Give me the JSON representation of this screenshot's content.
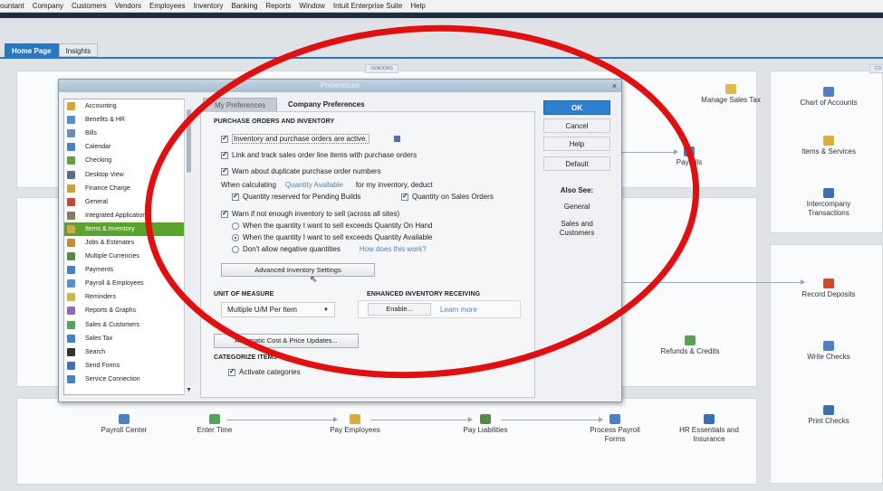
{
  "menu": [
    "ountant",
    "Company",
    "Customers",
    "Vendors",
    "Employees",
    "Inventory",
    "Banking",
    "Reports",
    "Window",
    "Intuit Enterprise Suite",
    "Help"
  ],
  "home": {
    "tabs": [
      "Home Page",
      "Insights"
    ],
    "section_vendors": "VENDORS",
    "right_top": [
      {
        "label": "Manage Sales Tax",
        "icon": "sales-tax-icon"
      },
      {
        "label": "Chart of Accounts",
        "icon": "chart-of-accounts-icon"
      },
      {
        "label": "Items & Services",
        "icon": "items-services-icon"
      },
      {
        "label": "Intercompany Transactions",
        "icon": "intercompany-icon"
      }
    ],
    "payrolls": "Payrolls",
    "record_deposits": "Record Deposits",
    "refunds_credits": "Refunds & Credits",
    "write_checks": "Write Checks",
    "print_checks": "Print Checks",
    "bottom": [
      {
        "label": "Payroll Center",
        "icon": "payroll-center-icon"
      },
      {
        "label": "Enter Time",
        "icon": "enter-time-icon"
      },
      {
        "label": "Pay Employees",
        "icon": "pay-employees-icon"
      },
      {
        "label": "Pay Liabilities",
        "icon": "pay-liabilities-icon"
      },
      {
        "label": "Process Payroll Forms",
        "icon": "payroll-forms-icon"
      },
      {
        "label": "HR Essentials and Insurance",
        "icon": "hr-essentials-icon"
      }
    ]
  },
  "dialog": {
    "title": "Preferences",
    "close": "×",
    "categories": [
      {
        "label": "Accounting",
        "color": "#d4a637"
      },
      {
        "label": "Benefits & HR",
        "color": "#5b8ec9"
      },
      {
        "label": "Bills",
        "color": "#6a8fb5"
      },
      {
        "label": "Calendar",
        "color": "#4a7fc0"
      },
      {
        "label": "Checking",
        "color": "#6b9b4a"
      },
      {
        "label": "Desktop View",
        "color": "#5d6f84"
      },
      {
        "label": "Finance Charge",
        "color": "#c9a240"
      },
      {
        "label": "General",
        "color": "#c14a3a"
      },
      {
        "label": "Integrated Applications",
        "color": "#8c7b5e"
      },
      {
        "label": "Items & Inventory",
        "color": "#d1a84a"
      },
      {
        "label": "Jobs & Estimates",
        "color": "#c48a3a"
      },
      {
        "label": "Multiple Currencies",
        "color": "#5a8a4a"
      },
      {
        "label": "Payments",
        "color": "#4a7fc0"
      },
      {
        "label": "Payroll & Employees",
        "color": "#5b8ec9"
      },
      {
        "label": "Reminders",
        "color": "#d2b44e"
      },
      {
        "label": "Reports & Graphs",
        "color": "#8a6fb0"
      },
      {
        "label": "Sales & Customers",
        "color": "#5aa05a"
      },
      {
        "label": "Sales Tax",
        "color": "#4a7fc0"
      },
      {
        "label": "Search",
        "color": "#333333"
      },
      {
        "label": "Send Forms",
        "color": "#4a6fa5"
      },
      {
        "label": "Service Connection",
        "color": "#4a7fc0"
      }
    ],
    "selected_category": "Items & Inventory",
    "tab_my": "My Preferences",
    "tab_company": "Company Preferences",
    "purchase_heading": "PURCHASE ORDERS AND INVENTORY",
    "opt_inventory_active": "Inventory and purchase orders are active.",
    "opt_link_track": "Link and track sales order line items with purchase orders",
    "opt_warn_duplicate": "Warn about duplicate purchase order numbers",
    "when_calculating": "When calculating",
    "quantity_available": "Quantity Available",
    "for_my_inventory": "for my inventory, deduct",
    "qty_reserved": "Quantity reserved for Pending Builds",
    "qty_sales_orders": "Quantity on Sales Orders",
    "warn_not_enough": "Warn if not enough inventory to sell (across all sites)",
    "radio_on_hand": "When the quantity I want to sell exceeds Quantity On Hand",
    "radio_available": "When the quantity I want to sell exceeds Quantity Available",
    "radio_dont_allow": "Don't allow negative quantities",
    "how_does_this_work": "How does this work?",
    "advanced_button": "Advanced Inventory Settings",
    "uom_heading": "UNIT OF MEASURE",
    "uom_value": "Multiple U/M Per Item",
    "eir_heading": "ENHANCED INVENTORY RECEIVING",
    "enable_button": "Enable...",
    "learn_more": "Learn more",
    "auto_cost_button": "Automatic Cost & Price Updates...",
    "cat_items_heading": "CATEGORIZE ITEMS",
    "activate_categories": "Activate categories",
    "ok": "OK",
    "cancel": "Cancel",
    "help": "Help",
    "default": "Default",
    "also_see": "Also See:",
    "also_general": "General",
    "also_sales": "Sales and Customers"
  },
  "colors": {
    "accent": "#2b78c2",
    "annotation": "#e01010",
    "selected": "#59a52c"
  }
}
